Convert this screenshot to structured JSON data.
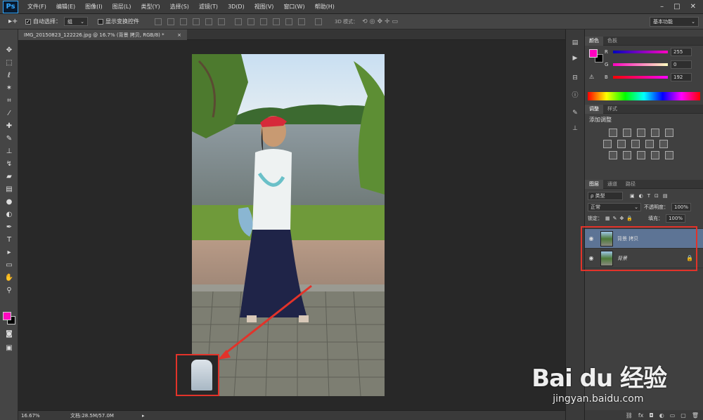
{
  "menubar": {
    "logo": "Ps",
    "items": [
      "文件(F)",
      "编辑(E)",
      "图像(I)",
      "图层(L)",
      "类型(Y)",
      "选择(S)",
      "滤镜(T)",
      "3D(D)",
      "视图(V)",
      "窗口(W)",
      "帮助(H)"
    ],
    "controls": [
      "–",
      "□",
      "✕"
    ]
  },
  "options": {
    "tool_icon": "▸+",
    "auto_select_label": "自动选择：",
    "auto_select_value": "组",
    "show_transform_label": "显示变换控件",
    "mode_3d_label": "3D 模式：",
    "workspace": "基本功能"
  },
  "document": {
    "tab_title": "IMG_20150823_122226.jpg @ 16.7% (背景 拷贝, RGB/8) *",
    "tab_close": "×"
  },
  "status": {
    "zoom": "16.67%",
    "doc_info": "文档:28.5M/57.0M"
  },
  "color_panel": {
    "tabs": [
      "颜色",
      "色板"
    ],
    "r_label": "R",
    "r_value": "255",
    "g_label": "G",
    "g_value": "0",
    "b_label": "B",
    "b_value": "192",
    "fg_color": "#ff00c0",
    "bg_color": "#000000"
  },
  "adjust_panel": {
    "tabs": [
      "调整",
      "样式"
    ],
    "title": "添加调整"
  },
  "layers_panel": {
    "tabs": [
      "图层",
      "通道",
      "路径"
    ],
    "filter_label": "ρ 类型",
    "blend_mode": "正常",
    "opacity_label": "不透明度：",
    "opacity_value": "100%",
    "lock_label": "锁定：",
    "fill_label": "填充：",
    "fill_value": "100%",
    "layers": [
      {
        "name": "背景 拷贝",
        "selected": true
      },
      {
        "name": "背景",
        "selected": false,
        "locked": true
      }
    ]
  },
  "watermark": {
    "logo": "Bai du 经验",
    "url": "jingyan.baidu.com"
  }
}
